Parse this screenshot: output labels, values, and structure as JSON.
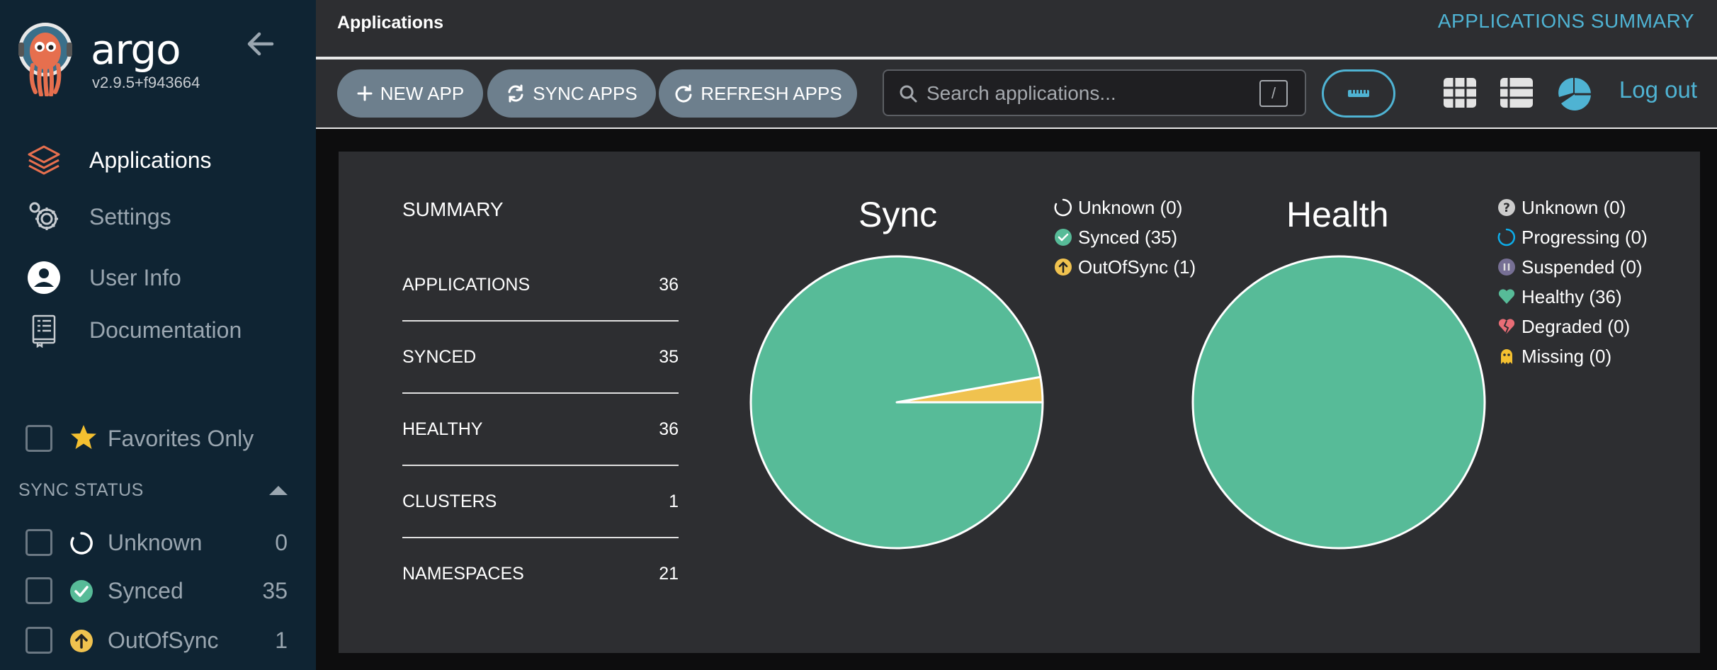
{
  "brand": {
    "name": "argo",
    "version": "v2.9.5+f943664"
  },
  "nav": [
    {
      "label": "Applications",
      "icon": "stack-icon",
      "active": true
    },
    {
      "label": "Settings",
      "icon": "gear-icon",
      "active": false
    },
    {
      "label": "User Info",
      "icon": "user-icon",
      "active": false
    },
    {
      "label": "Documentation",
      "icon": "book-icon",
      "active": false
    }
  ],
  "filters": {
    "favorites_label": "Favorites Only",
    "sync_status_heading": "SYNC STATUS",
    "sync_items": [
      {
        "label": "Unknown",
        "count": "0",
        "icon": "circle-notch-icon"
      },
      {
        "label": "Synced",
        "count": "35",
        "icon": "check-circle-icon"
      },
      {
        "label": "OutOfSync",
        "count": "1",
        "icon": "arrow-up-circle-icon"
      }
    ]
  },
  "header": {
    "title": "Applications",
    "summary_title": "APPLICATIONS SUMMARY"
  },
  "toolbar": {
    "new_app": "NEW APP",
    "sync_apps": "SYNC APPS",
    "refresh_apps": "REFRESH APPS",
    "search_placeholder": "Search applications...",
    "search_shortcut": "/",
    "logout": "Log out"
  },
  "summary": {
    "heading": "SUMMARY",
    "rows": [
      {
        "label": "APPLICATIONS",
        "value": "36"
      },
      {
        "label": "SYNCED",
        "value": "35"
      },
      {
        "label": "HEALTHY",
        "value": "36"
      },
      {
        "label": "CLUSTERS",
        "value": "1"
      },
      {
        "label": "NAMESPACES",
        "value": "21"
      }
    ]
  },
  "colors": {
    "synced": "#57bb98",
    "outofsync": "#f0c24f",
    "accent": "#4fb3d3",
    "degraded": "#e96d76",
    "suspended": "#766f94",
    "progressing": "#0dadea"
  },
  "chart_data": [
    {
      "type": "pie",
      "title": "Sync",
      "categories": [
        "Unknown",
        "Synced",
        "OutOfSync"
      ],
      "values": [
        0,
        35,
        1
      ],
      "legend": [
        "Unknown (0)",
        "Synced (35)",
        "OutOfSync (1)"
      ],
      "colors": [
        "#ffffff",
        "#57bb98",
        "#f0c24f"
      ],
      "legend_position": "top-right"
    },
    {
      "type": "pie",
      "title": "Health",
      "categories": [
        "Unknown",
        "Progressing",
        "Suspended",
        "Healthy",
        "Degraded",
        "Missing"
      ],
      "values": [
        0,
        0,
        0,
        36,
        0,
        0
      ],
      "legend": [
        "Unknown (0)",
        "Progressing (0)",
        "Suspended (0)",
        "Healthy (36)",
        "Degraded (0)",
        "Missing (0)"
      ],
      "colors": [
        "#cccccc",
        "#0dadea",
        "#766f94",
        "#57bb98",
        "#e96d76",
        "#f4c030"
      ],
      "legend_position": "top-right"
    }
  ]
}
